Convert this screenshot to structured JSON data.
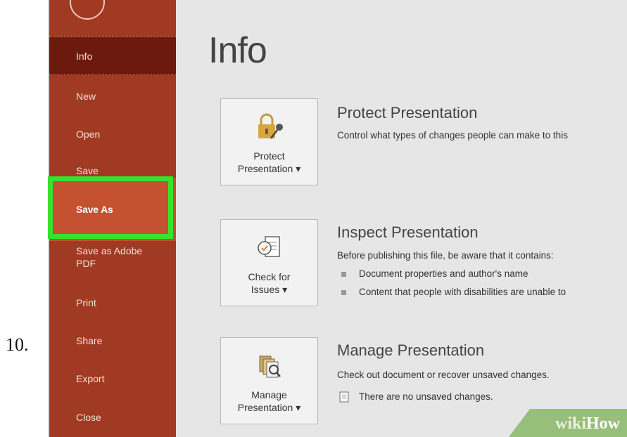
{
  "step": {
    "number": "10."
  },
  "sidebar": {
    "items": [
      {
        "label": "Info"
      },
      {
        "label": "New"
      },
      {
        "label": "Open"
      },
      {
        "label": "Save"
      },
      {
        "label": "Save As"
      },
      {
        "label": "Save as Adobe\nPDF"
      },
      {
        "label": "Print"
      },
      {
        "label": "Share"
      },
      {
        "label": "Export"
      },
      {
        "label": "Close"
      }
    ],
    "highlight_color": "#37e22d",
    "background": "#a03a22"
  },
  "main": {
    "title": "Info",
    "sections": [
      {
        "button_label": "Protect\nPresentation ▾",
        "title": "Protect Presentation",
        "description": "Control what types of changes people can make to this"
      },
      {
        "button_label": "Check for\nIssues ▾",
        "title": "Inspect Presentation",
        "description": "Before publishing this file, be aware that it contains:",
        "bullets": [
          "Document properties and author's name",
          "Content that people with disabilities are unable to"
        ]
      },
      {
        "button_label": "Manage\nPresentation ▾",
        "title": "Manage Presentation",
        "description": "Check out document or recover unsaved changes.",
        "note": "There are no unsaved changes."
      }
    ]
  },
  "watermark": {
    "wiki": "wiki",
    "how": "How"
  }
}
